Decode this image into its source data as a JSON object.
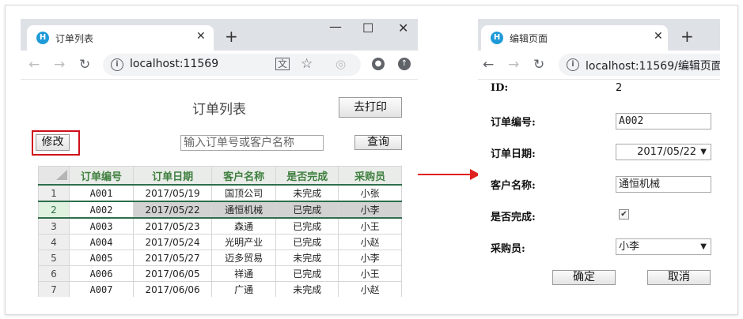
{
  "left_window": {
    "tab_title": "订单列表",
    "url": "localhost:11569",
    "page_title": "订单列表",
    "print_button": "去打印",
    "edit_button": "修改",
    "search_placeholder": "输入订单号或客户名称",
    "query_button": "查询",
    "columns": [
      "订单编号",
      "订单日期",
      "客户名称",
      "是否完成",
      "采购员"
    ],
    "rows": [
      {
        "no": "1",
        "id": "A001",
        "date": "2017/05/19",
        "customer": "国顶公司",
        "done": "未完成",
        "buyer": "小张"
      },
      {
        "no": "2",
        "id": "A002",
        "date": "2017/05/22",
        "customer": "通恒机械",
        "done": "已完成",
        "buyer": "小李"
      },
      {
        "no": "3",
        "id": "A003",
        "date": "2017/05/23",
        "customer": "森通",
        "done": "已完成",
        "buyer": "小王"
      },
      {
        "no": "4",
        "id": "A004",
        "date": "2017/05/24",
        "customer": "光明产业",
        "done": "已完成",
        "buyer": "小赵"
      },
      {
        "no": "5",
        "id": "A005",
        "date": "2017/05/27",
        "customer": "迈多贸易",
        "done": "未完成",
        "buyer": "小李"
      },
      {
        "no": "6",
        "id": "A006",
        "date": "2017/06/05",
        "customer": "祥通",
        "done": "已完成",
        "buyer": "小王"
      },
      {
        "no": "7",
        "id": "A007",
        "date": "2017/06/06",
        "customer": "广通",
        "done": "未完成",
        "buyer": "小赵"
      }
    ],
    "selected_row": "2"
  },
  "right_window": {
    "tab_title": "编辑页面",
    "url": "localhost:11569/编辑页面",
    "form": {
      "id_label": "ID:",
      "id_value": "2",
      "order_no_label": "订单编号:",
      "order_no_value": "A002",
      "order_date_label": "订单日期:",
      "order_date_value": "2017/05/22",
      "customer_label": "客户名称:",
      "customer_value": "通恒机械",
      "done_label": "是否完成:",
      "done_checked": true,
      "buyer_label": "采购员:",
      "buyer_value": "小李",
      "ok_button": "确定",
      "cancel_button": "取消"
    }
  },
  "colors": {
    "highlight_border": "#d0101b",
    "arrow": "#e02020",
    "header_text": "#3f7f3f",
    "selection": "#2e6e4c",
    "favicon": "#1e9ad8"
  }
}
